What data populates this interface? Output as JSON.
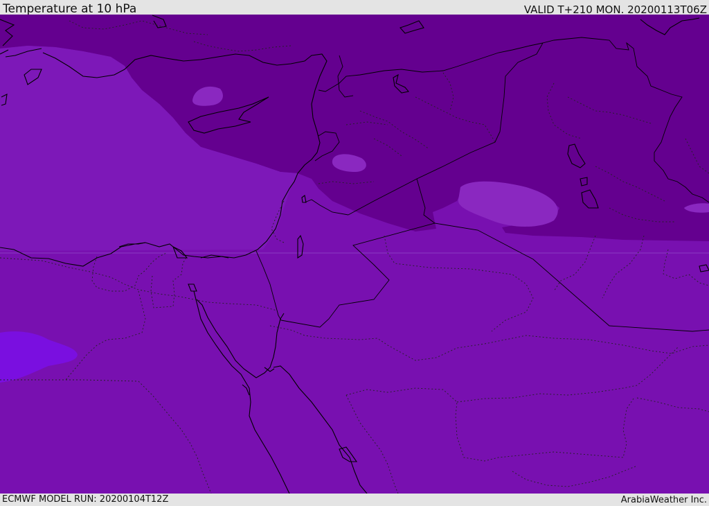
{
  "header": {
    "title": "Temperature at 10 hPa",
    "valid_time": "VALID T+210 MON. 20200113T06Z"
  },
  "footer": {
    "model_run": "ECMWF MODEL RUN: 20200104T12Z",
    "credit": "ArabiaWeather Inc."
  },
  "map": {
    "region": "Eastern Mediterranean / Middle East",
    "layers": [
      "temperature-shading",
      "coastlines",
      "country-borders",
      "province-borders"
    ],
    "colors": {
      "shade_base": "#7810b0",
      "shade_cold": "#64008f",
      "shade_light": "#8a28c0",
      "shade_warm": "#7a10e0",
      "coastline": "#000000",
      "borders": "#000000"
    }
  }
}
